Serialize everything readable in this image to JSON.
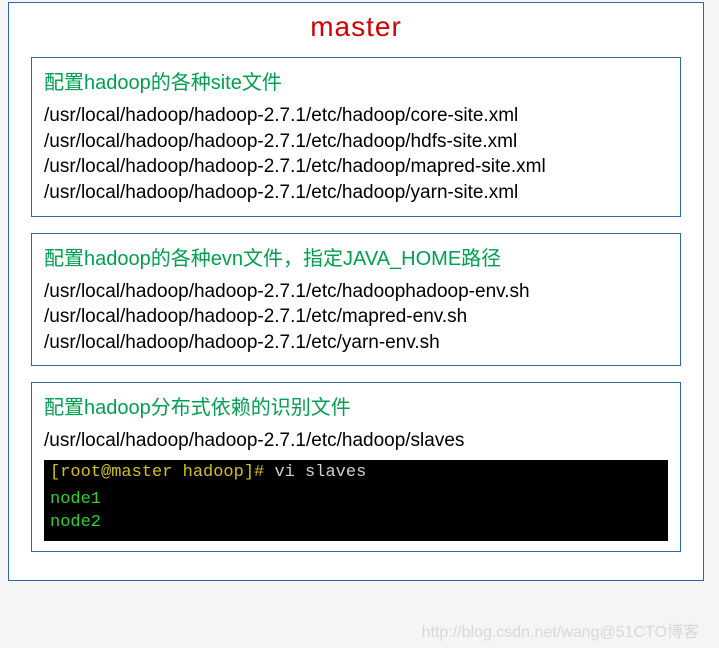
{
  "title": "master",
  "section1": {
    "header": "配置hadoop的各种site文件",
    "lines": [
      "/usr/local/hadoop/hadoop-2.7.1/etc/hadoop/core-site.xml",
      "/usr/local/hadoop/hadoop-2.7.1/etc/hadoop/hdfs-site.xml",
      "/usr/local/hadoop/hadoop-2.7.1/etc/hadoop/mapred-site.xml",
      "/usr/local/hadoop/hadoop-2.7.1/etc/hadoop/yarn-site.xml"
    ]
  },
  "section2": {
    "header": "配置hadoop的各种evn文件，指定JAVA_HOME路径",
    "lines": [
      "/usr/local/hadoop/hadoop-2.7.1/etc/hadoophadoop-env.sh",
      "/usr/local/hadoop/hadoop-2.7.1/etc/mapred-env.sh",
      "/usr/local/hadoop/hadoop-2.7.1/etc/yarn-env.sh"
    ]
  },
  "section3": {
    "header": "配置hadoop分布式依赖的识别文件",
    "path": "/usr/local/hadoop/hadoop-2.7.1/etc/hadoop/slaves",
    "terminal": {
      "prompt_user": "[root@master hadoop]#",
      "prompt_cmd": " vi slaves",
      "out1": "node1",
      "out2": "node2"
    }
  },
  "watermark": "http://blog.csdn.net/wang@51CTO博客"
}
